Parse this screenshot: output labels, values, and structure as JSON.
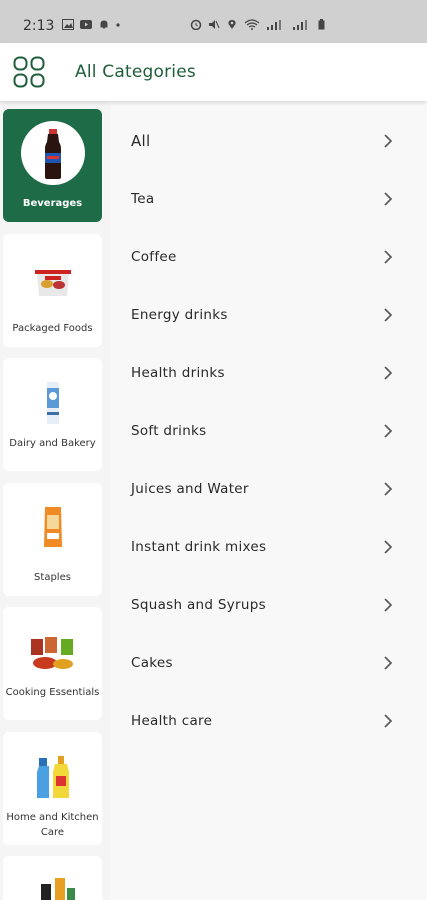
{
  "status_bar": {
    "time": "2:13"
  },
  "app_bar": {
    "title": "All Categories"
  },
  "sidebar": {
    "items": [
      {
        "label": "Beverages",
        "active": true
      },
      {
        "label": "Packaged Foods"
      },
      {
        "label": "Dairy and Bakery"
      },
      {
        "label": "Staples"
      },
      {
        "label": "Cooking Essentials"
      },
      {
        "label": "Home and Kitchen Care"
      }
    ]
  },
  "subcategories": [
    {
      "label": "All"
    },
    {
      "label": "Tea"
    },
    {
      "label": "Coffee"
    },
    {
      "label": "Energy drinks"
    },
    {
      "label": "Health drinks"
    },
    {
      "label": "Soft drinks"
    },
    {
      "label": "Juices and Water"
    },
    {
      "label": "Instant drink mixes"
    },
    {
      "label": "Squash and Syrups"
    },
    {
      "label": "Cakes"
    },
    {
      "label": "Health care"
    }
  ],
  "colors": {
    "brand_green": "#1d6b47",
    "title_green": "#1f5e3b"
  }
}
